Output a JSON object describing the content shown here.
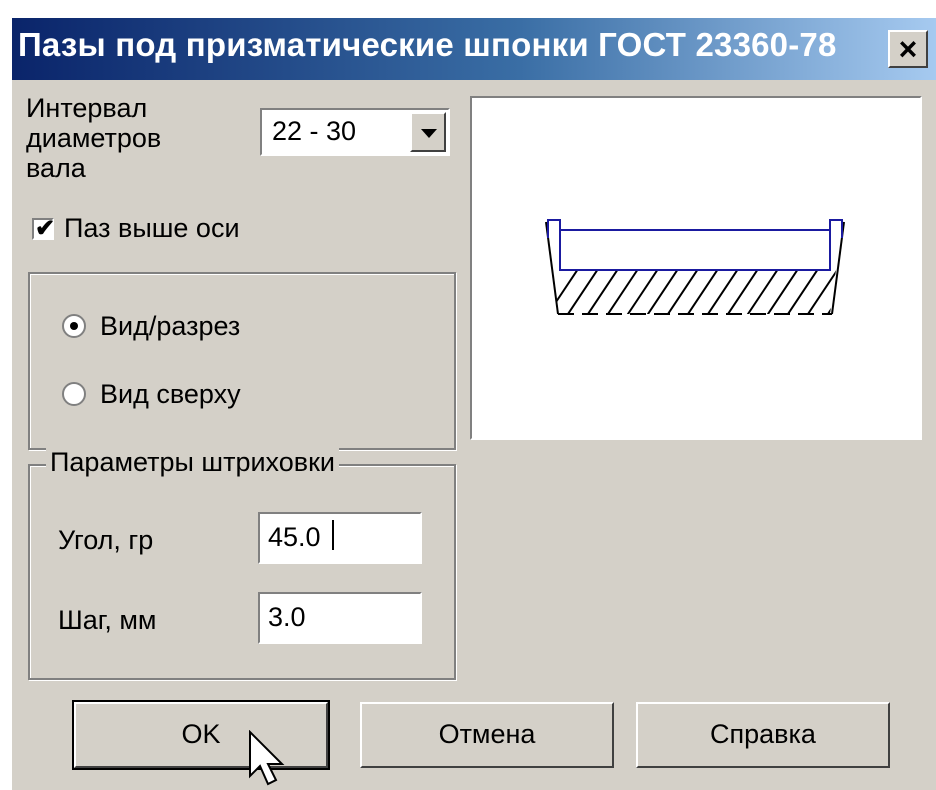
{
  "window": {
    "title": "Пазы под призматические шпонки ГОСТ 23360-78",
    "close_label": "×"
  },
  "diameter": {
    "label_line1": "Интервал",
    "label_line2": "диаметров",
    "label_line3": "вала",
    "value": "22 - 30"
  },
  "slot_above_axis": {
    "label": "Паз выше оси",
    "checked": true
  },
  "view_group": {
    "options": [
      {
        "label": "Вид/разрез",
        "selected": true
      },
      {
        "label": "Вид сверху",
        "selected": false
      }
    ]
  },
  "hatch": {
    "group_title": "Параметры штриховки",
    "angle_label": "Угол, гр",
    "angle_value": "45.0",
    "step_label": "Шаг, мм",
    "step_value": "3.0"
  },
  "buttons": {
    "ok": "OK",
    "cancel": "Отмена",
    "help": "Справка"
  },
  "colors": {
    "title_start": "#0a246a",
    "title_end": "#a6caf0",
    "preview_outline": "#1a1aa0"
  }
}
